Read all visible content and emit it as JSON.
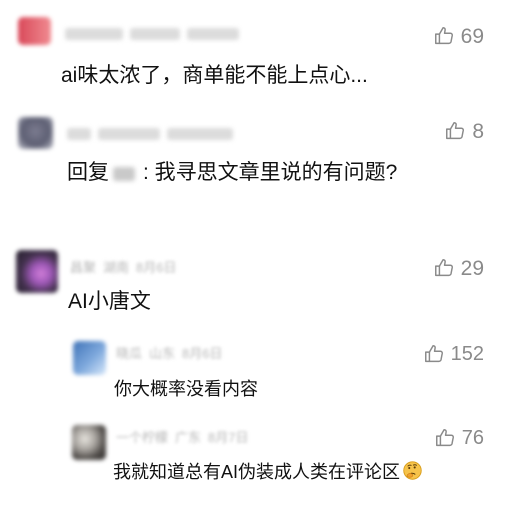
{
  "comments": [
    {
      "id": "c1",
      "likes": "69",
      "text": "ai味太浓了，商单能不能上点心..."
    },
    {
      "id": "c2",
      "likes": "8",
      "text_prefix": "回复",
      "text_suffix": ": 我寻思文章里说的有问题?"
    },
    {
      "id": "c3",
      "author": "昌聚",
      "location": "湖南",
      "date": "8月6日",
      "likes": "29",
      "text": "AI小唐文"
    }
  ],
  "replies": [
    {
      "id": "r1",
      "author": "晓瓜",
      "location": "山东",
      "date": "8月6日",
      "likes": "152",
      "text": "你大概率没看内容"
    },
    {
      "id": "r2",
      "author": "一个柠檬",
      "location": "广东",
      "date": "8月7日",
      "likes": "76",
      "text": "我就知道总有AI伪装成人类在评论区",
      "emoji": "thinking-face-icon"
    }
  ]
}
